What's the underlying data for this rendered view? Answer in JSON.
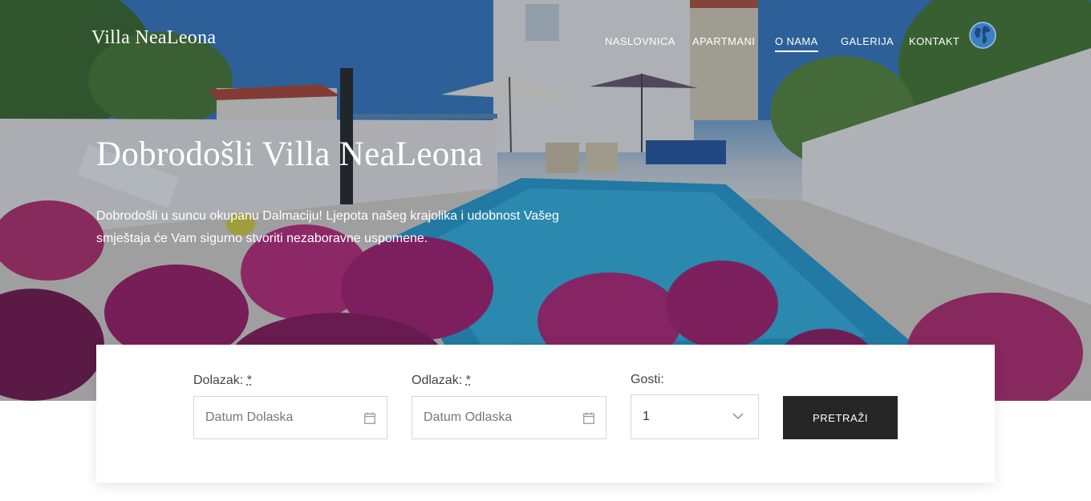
{
  "brand": {
    "name": "Villa NeaLeona"
  },
  "nav": {
    "items": [
      {
        "label": "NASLOVNICA"
      },
      {
        "label": "APARTMANI"
      },
      {
        "label": "O NAMA"
      },
      {
        "label": "GALERIJA"
      },
      {
        "label": "KONTAKT"
      }
    ],
    "active_item": "O NAMA",
    "language_icon": "globe-icon"
  },
  "hero": {
    "title": "Dobrodošli Villa NeaLeona",
    "text": "Dobrodošli u suncu okupanu Dalmaciju! Ljepota našeg krajolika i udobnost Vašeg smještaja će Vam sigurno stvoriti nezaboravne uspomene."
  },
  "search": {
    "arrival": {
      "label": "Dolazak:",
      "required_mark": "*",
      "placeholder": "Datum Dolaska",
      "icon": "calendar-icon"
    },
    "departure": {
      "label": "Odlazak:",
      "required_mark": "*",
      "placeholder": "Datum Odlaska",
      "icon": "calendar-icon"
    },
    "guests": {
      "label": "Gosti:",
      "value": "1",
      "icon": "chevron-down-icon"
    },
    "submit_label": "PRETRAŽI"
  },
  "colors": {
    "button_bg": "#262626",
    "text": "#444444",
    "white": "#ffffff"
  }
}
